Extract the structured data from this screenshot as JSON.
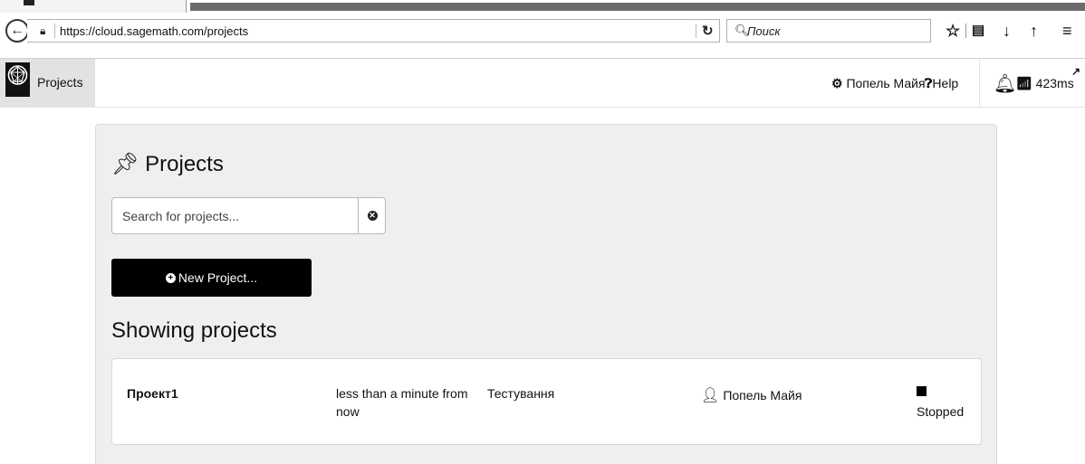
{
  "browser": {
    "url": "https://cloud.sagemath.com/projects",
    "search_placeholder": "Поиск",
    "icons": [
      "back-arrow-icon",
      "lock-icon",
      "reload-icon",
      "search-icon",
      "bookmark-star-icon",
      "reading-list-icon",
      "download-icon",
      "home-icon",
      "menu-icon"
    ]
  },
  "header": {
    "projects_tab": "Projects",
    "account_label": "Попель Майя",
    "help_label": "Help",
    "ping": "423ms"
  },
  "main": {
    "title": "Projects",
    "search_placeholder": "Search for projects...",
    "new_project_label": "New Project...",
    "section_title": "Showing projects"
  },
  "projects": [
    {
      "name": "Проект1",
      "last_edited": "less than a minute from now",
      "description": "Тестування",
      "owner": "Попель Майя",
      "state": "Stopped"
    }
  ],
  "colors": {
    "panel_bg": "#efefef",
    "button_bg": "#000000",
    "active_tab_bg": "#e2e2e2"
  }
}
